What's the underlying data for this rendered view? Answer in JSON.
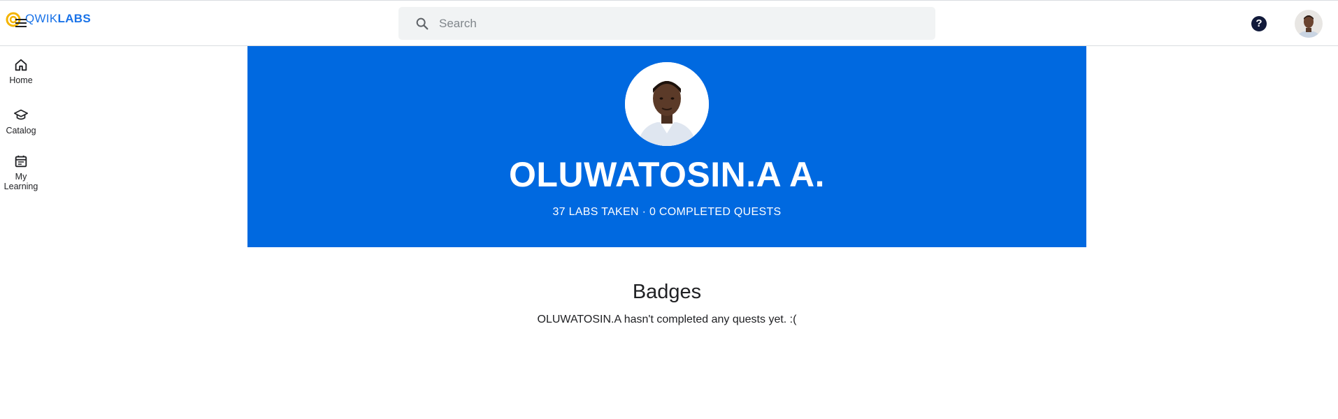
{
  "app": {
    "logo_text_light": "QWIK",
    "logo_text_bold": "LABS",
    "brand_color": "#1a73e8"
  },
  "search": {
    "placeholder": "Search",
    "value": ""
  },
  "header": {
    "help_icon": "help-icon",
    "help_glyph": "?"
  },
  "sidebar": {
    "items": [
      {
        "label": "Home",
        "icon": "home-icon"
      },
      {
        "label": "Catalog",
        "icon": "graduation-cap-icon"
      },
      {
        "label": "My Learning",
        "icon": "calendar-icon"
      }
    ]
  },
  "profile": {
    "name": "OLUWATOSIN.A A.",
    "stats": "37 LABS TAKEN · 0 COMPLETED QUESTS",
    "banner_color": "#0069e0"
  },
  "badges": {
    "title": "Badges",
    "message": "OLUWATOSIN.A hasn't completed any quests yet. :("
  }
}
